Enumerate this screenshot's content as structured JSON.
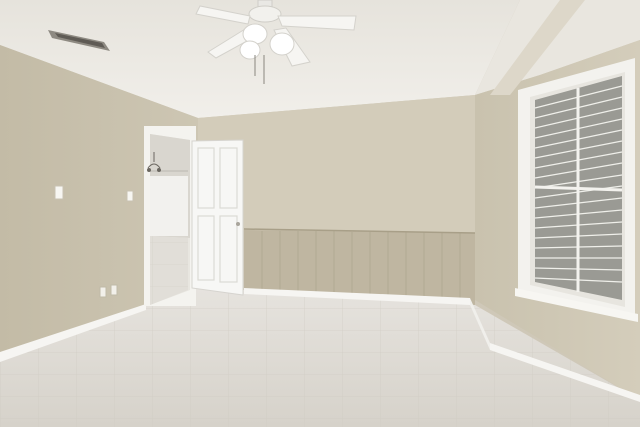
{
  "scene": {
    "description_label": "",
    "colors": {
      "ceiling": "#ece9e3",
      "wall_left": "#c9c2ae",
      "wall_back": "#d2cbb8",
      "wall_right": "#cbc4b1",
      "wainscot": "#bfb6a1",
      "floor": "#dedbd4",
      "trim": "#ffffff",
      "door": "#f7f7f5"
    },
    "icons": [
      "ceiling-fan-icon",
      "air-vent-icon",
      "window-blinds-icon",
      "light-switch-icon",
      "power-outlet-icon"
    ]
  }
}
